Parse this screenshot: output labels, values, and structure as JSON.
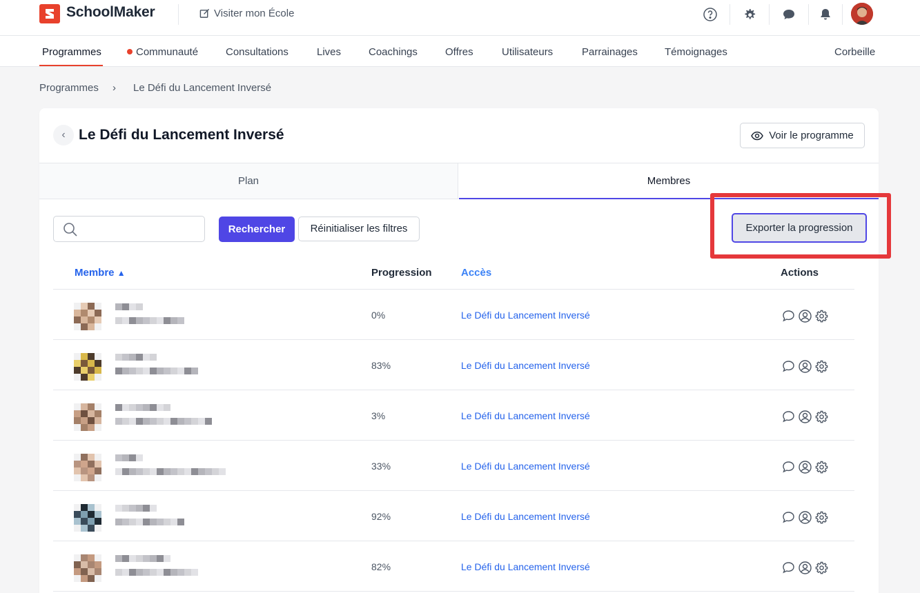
{
  "app": {
    "name": "SchoolMaker",
    "visit_label": "Visiter mon École"
  },
  "nav": {
    "items": [
      "Programmes",
      "Communauté",
      "Consultations",
      "Lives",
      "Coachings",
      "Offres",
      "Utilisateurs",
      "Parrainages",
      "Témoignages"
    ],
    "trash": "Corbeille",
    "active": "Programmes"
  },
  "breadcrumb": {
    "root": "Programmes",
    "current": "Le Défi du Lancement Inversé"
  },
  "program": {
    "title": "Le Défi du Lancement Inversé",
    "view_label": "Voir le programme"
  },
  "tabs": {
    "plan": "Plan",
    "members": "Membres"
  },
  "toolbar": {
    "search_placeholder": "",
    "search_label": "Rechercher",
    "reset_label": "Réinitialiser les filtres",
    "export_label": "Exporter la progression"
  },
  "table": {
    "headers": {
      "member": "Membre",
      "progress": "Progression",
      "access": "Accès",
      "actions": "Actions"
    },
    "rows": [
      {
        "progress": "0%",
        "access": "Le Défi du Lancement Inversé"
      },
      {
        "progress": "83%",
        "access": "Le Défi du Lancement Inversé"
      },
      {
        "progress": "3%",
        "access": "Le Défi du Lancement Inversé"
      },
      {
        "progress": "33%",
        "access": "Le Défi du Lancement Inversé"
      },
      {
        "progress": "92%",
        "access": "Le Défi du Lancement Inversé"
      },
      {
        "progress": "82%",
        "access": "Le Défi du Lancement Inversé"
      }
    ]
  },
  "colors": {
    "brand": "#e8412c",
    "primary": "#4f46e5",
    "link": "#2563eb",
    "highlight": "#e5383b"
  }
}
